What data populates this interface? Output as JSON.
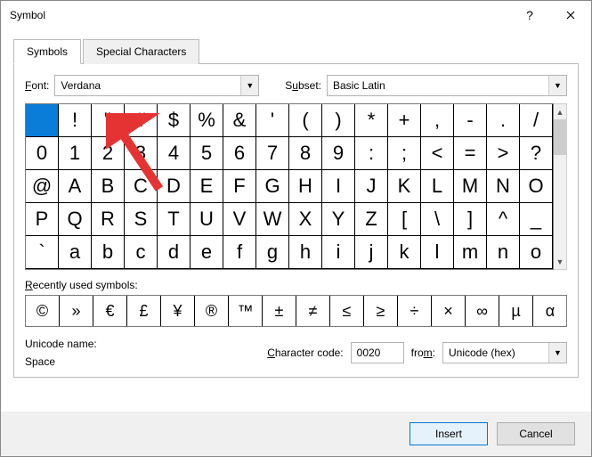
{
  "window": {
    "title": "Symbol"
  },
  "tabs": {
    "symbols": "Symbols",
    "special": "Special Characters"
  },
  "font": {
    "label": "Font:",
    "value": "Verdana"
  },
  "subset": {
    "label": "Subset:",
    "value": "Basic Latin"
  },
  "grid": [
    " ",
    "!",
    "\"",
    "#",
    "$",
    "%",
    "&",
    "'",
    "(",
    ")",
    "*",
    "+",
    ",",
    "-",
    ".",
    "/",
    "0",
    "1",
    "2",
    "3",
    "4",
    "5",
    "6",
    "7",
    "8",
    "9",
    ":",
    ";",
    "<",
    "=",
    ">",
    "?",
    "@",
    "A",
    "B",
    "C",
    "D",
    "E",
    "F",
    "G",
    "H",
    "I",
    "J",
    "K",
    "L",
    "M",
    "N",
    "O",
    "P",
    "Q",
    "R",
    "S",
    "T",
    "U",
    "V",
    "W",
    "X",
    "Y",
    "Z",
    "[",
    "\\",
    "]",
    "^",
    "_",
    "`",
    "a",
    "b",
    "c",
    "d",
    "e",
    "f",
    "g",
    "h",
    "i",
    "j",
    "k",
    "l",
    "m",
    "n",
    "o"
  ],
  "selected_index": 0,
  "recent": {
    "label": "Recently used symbols:"
  },
  "recent_grid": [
    "©",
    "»",
    "€",
    "£",
    "¥",
    "®",
    "™",
    "±",
    "≠",
    "≤",
    "≥",
    "÷",
    "×",
    "∞",
    "µ",
    "α"
  ],
  "unicode": {
    "label": "Unicode name:",
    "value": "Space"
  },
  "charcode": {
    "label": "Character code:",
    "value": "0020"
  },
  "from": {
    "label": "from:",
    "value": "Unicode (hex)"
  },
  "buttons": {
    "insert": "Insert",
    "cancel": "Cancel"
  }
}
